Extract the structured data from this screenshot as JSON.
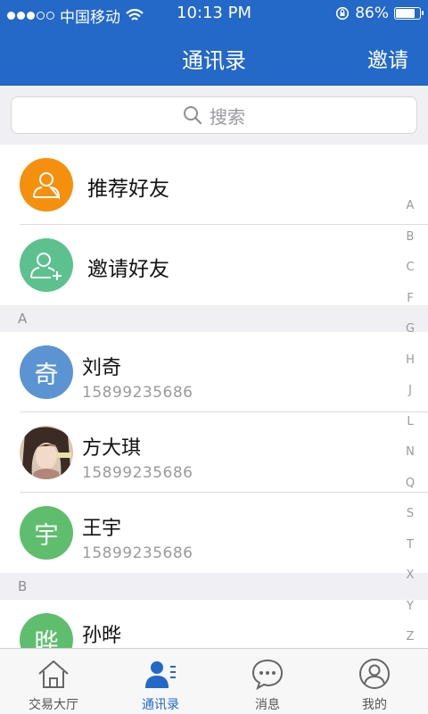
{
  "status_bar": {
    "carrier": "中国移动",
    "time": "10:13 PM",
    "battery": "86%",
    "battery_level": 0.86,
    "signal_filled": 3,
    "signal_total": 5
  },
  "nav": {
    "title": "通讯录",
    "action": "邀请"
  },
  "search": {
    "placeholder": "搜索"
  },
  "special_items": [
    {
      "label": "推荐好友",
      "color": "#f5900f",
      "icon": "person-icon"
    },
    {
      "label": "邀请好友",
      "color": "#5cc18f",
      "icon": "add-person-icon"
    }
  ],
  "sections": [
    {
      "header": "A",
      "contacts": [
        {
          "name": "刘奇",
          "phone": "15899235686",
          "avatar_char": "奇",
          "avatar_color": "#5b93d3"
        },
        {
          "name": "方大琪",
          "phone": "15899235686",
          "avatar_char": "",
          "avatar_color": "#caa98e"
        },
        {
          "name": "王宇",
          "phone": "15899235686",
          "avatar_char": "宇",
          "avatar_color": "#5fbe6d"
        }
      ]
    },
    {
      "header": "B",
      "contacts": [
        {
          "name": "孙晔",
          "phone": "",
          "avatar_char": "晔",
          "avatar_color": "#5fbe6d"
        }
      ]
    }
  ],
  "index_letters": [
    "A",
    "B",
    "C",
    "F",
    "G",
    "H",
    "J",
    "L",
    "N",
    "Q",
    "S",
    "T",
    "X",
    "Y",
    "Z"
  ],
  "tabs": [
    {
      "label": "交易大厅",
      "icon": "home-icon",
      "active": false
    },
    {
      "label": "通讯录",
      "icon": "contacts-icon",
      "active": true
    },
    {
      "label": "消息",
      "icon": "message-icon",
      "active": false
    },
    {
      "label": "我的",
      "icon": "profile-icon",
      "active": false
    }
  ],
  "colors": {
    "brand_blue": "#2468c8"
  }
}
